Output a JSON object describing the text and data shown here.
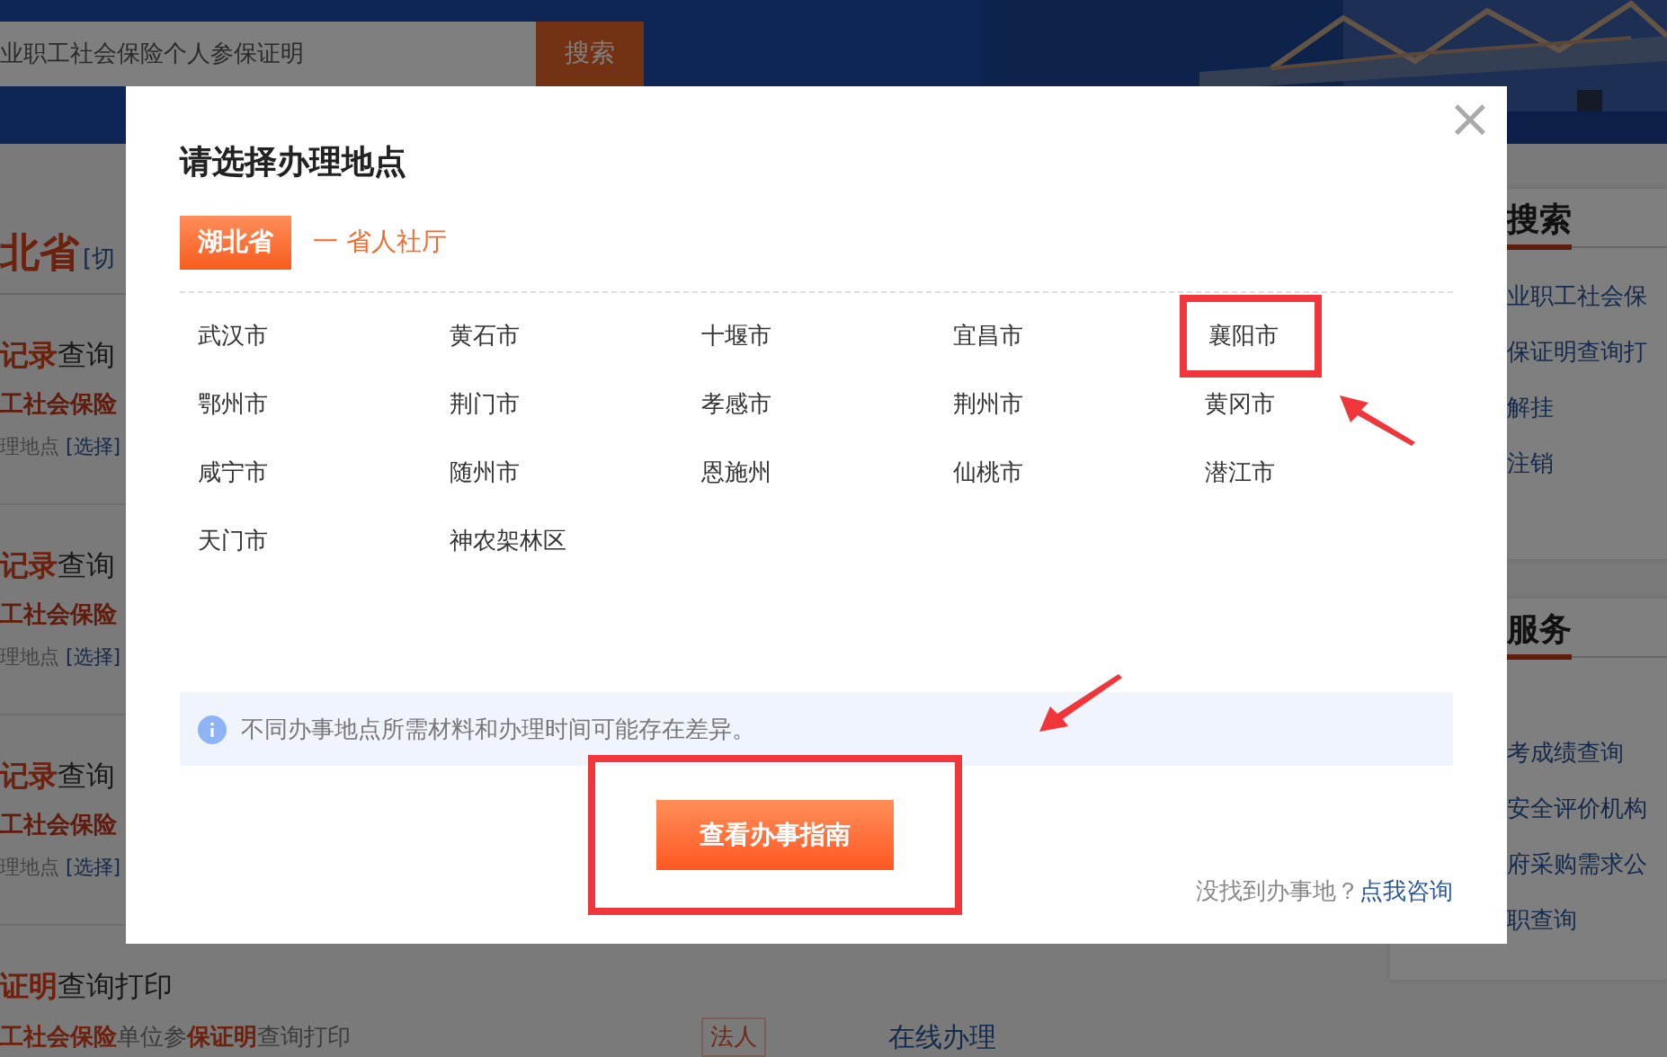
{
  "header": {
    "search": {
      "value": "业职工社会保险个人参保证明"
    },
    "search_button": "搜索"
  },
  "left": {
    "province": "北省",
    "switch": "[切",
    "records": [
      {
        "title": [
          {
            "text": "记录",
            "highlight": true
          },
          {
            "text": "查询",
            "highlight": false
          }
        ],
        "subtitle": "工社会保险",
        "place": "理地点",
        "choose": "[选择]"
      },
      {
        "title": [
          {
            "text": "记录",
            "highlight": true
          },
          {
            "text": "查询",
            "highlight": false
          }
        ],
        "subtitle": "工社会保险",
        "place": "理地点",
        "choose": "[选择]"
      },
      {
        "title": [
          {
            "text": "记录",
            "highlight": true
          },
          {
            "text": "查询",
            "highlight": false
          }
        ],
        "subtitle": "工社会保险",
        "place": "理地点",
        "choose": "[选择]"
      }
    ],
    "last": {
      "title": [
        {
          "text": "证明",
          "highlight": true
        },
        {
          "text": "查询打印",
          "highlight": false
        }
      ],
      "subtitle": [
        {
          "text": "工社会保险",
          "highlight": true
        },
        {
          "text": "单位参",
          "highlight": false
        },
        {
          "text": "保证明",
          "highlight": true
        },
        {
          "text": "查询打印",
          "highlight": false
        }
      ],
      "tag": "法人",
      "action": "在线办理"
    }
  },
  "right": [
    {
      "heading": "搜索",
      "links": [
        "业职工社会保",
        "保证明查询打",
        "解挂",
        "注销"
      ]
    },
    {
      "heading": "服务",
      "links": [
        "考成绩查询",
        "安全评价机构",
        "府采购需求公",
        "职查询"
      ]
    }
  ],
  "dialog": {
    "title": "请选择办理地点",
    "close": "×",
    "province": "湖北省",
    "department": "一 省人社厅",
    "cities": [
      {
        "name": "武汉市",
        "marked": false
      },
      {
        "name": "黄石市",
        "marked": false
      },
      {
        "name": "十堰市",
        "marked": false
      },
      {
        "name": "宜昌市",
        "marked": false
      },
      {
        "name": "襄阳市",
        "marked": true
      },
      {
        "name": "鄂州市",
        "marked": false
      },
      {
        "name": "荆门市",
        "marked": false
      },
      {
        "name": "孝感市",
        "marked": false
      },
      {
        "name": "荆州市",
        "marked": false
      },
      {
        "name": "黄冈市",
        "marked": false
      },
      {
        "name": "咸宁市",
        "marked": false
      },
      {
        "name": "随州市",
        "marked": false
      },
      {
        "name": "恩施州",
        "marked": false
      },
      {
        "name": "仙桃市",
        "marked": false
      },
      {
        "name": "潜江市",
        "marked": false
      },
      {
        "name": "天门市",
        "marked": false
      },
      {
        "name": "神农架林区",
        "marked": false
      }
    ],
    "notice": "不同办事地点所需材料和办理时间可能存在差异。",
    "button": {
      "label": "查看办事指南",
      "marked": true
    },
    "help": "没找到办事地？",
    "help_link": "点我咨询"
  }
}
